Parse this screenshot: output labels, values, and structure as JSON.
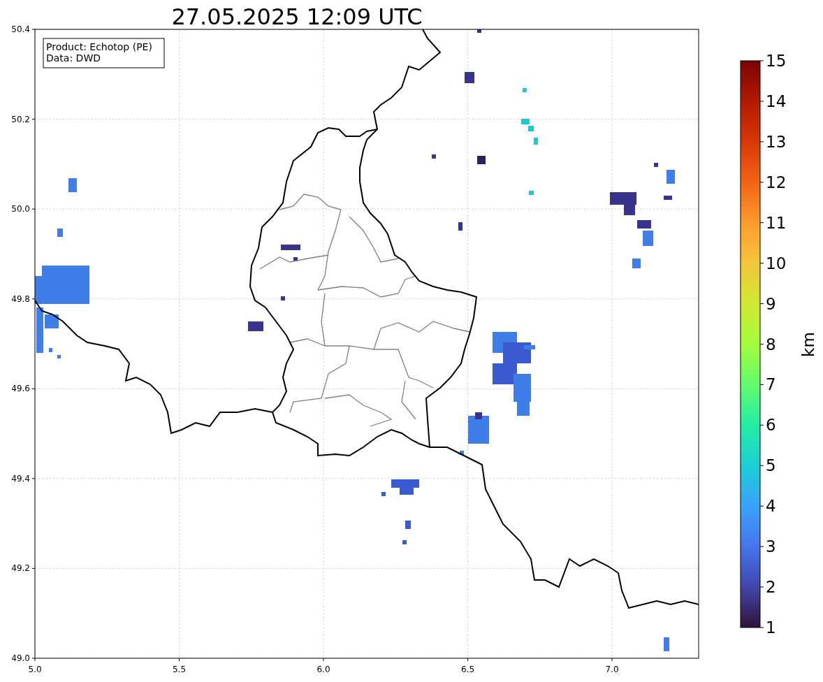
{
  "title": "27.05.2025 12:09 UTC",
  "legend": [
    "Product: Echotop (PE)",
    "Data: DWD"
  ],
  "map": {
    "xticks": [
      "5.0",
      "5.5",
      "6.0",
      "6.5",
      "7.0"
    ],
    "yticks": [
      "50.4",
      "50.2",
      "50.0",
      "49.8",
      "49.6",
      "49.4",
      "49.2",
      "49.0"
    ]
  },
  "colorbar": {
    "label": "km",
    "ticks": [
      "15",
      "14",
      "13",
      "12",
      "11",
      "10",
      "9",
      "8",
      "7",
      "6",
      "5",
      "4",
      "3",
      "2",
      "1"
    ]
  }
}
